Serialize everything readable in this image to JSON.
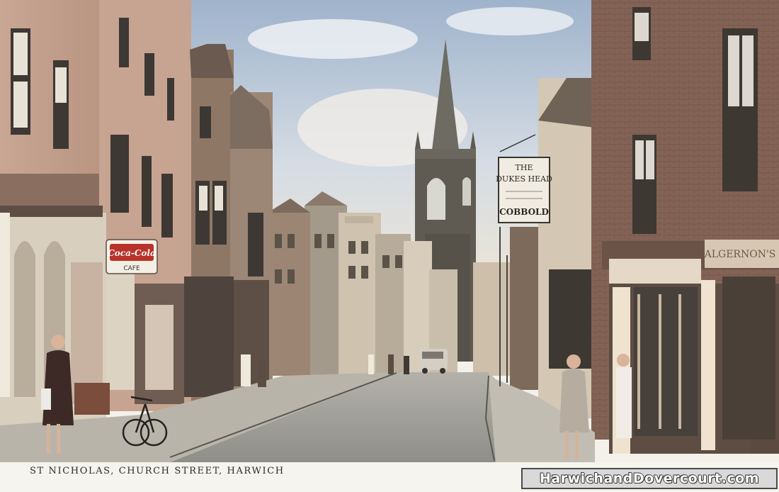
{
  "caption": "ST NICHOLAS, CHURCH STREET, HARWICH",
  "watermark": "HarwichandDovercourt.com",
  "signs": {
    "cafe_brand": "Coca-Cola",
    "cafe_word": "CAFE",
    "pub_line1": "THE",
    "pub_line2": "DUKES HEAD",
    "pub_line3": "COBBOLD",
    "shopfront_right": "ALGERNON'S"
  },
  "colors": {
    "sky": "#b9c7d8",
    "brick": "#8a6a55",
    "street": "#9d9c97",
    "cocacola_red": "#b8322a"
  }
}
